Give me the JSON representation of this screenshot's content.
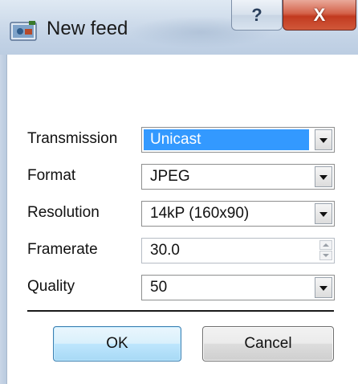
{
  "window": {
    "title": "New feed",
    "help_glyph": "?",
    "close_glyph": "X",
    "icon": "camera-feed-icon"
  },
  "form": {
    "transmission": {
      "label": "Transmission",
      "value": "Unicast",
      "selected": true
    },
    "format": {
      "label": "Format",
      "value": "JPEG"
    },
    "resolution": {
      "label": "Resolution",
      "value": "14kP (160x90)"
    },
    "framerate": {
      "label": "Framerate",
      "value": "30.0"
    },
    "quality": {
      "label": "Quality",
      "value": "50"
    }
  },
  "buttons": {
    "ok_label": "OK",
    "cancel_label": "Cancel"
  },
  "colors": {
    "selection": "#3399ff",
    "close_button": "#c23a1f",
    "default_button_border": "#3c7fb1"
  }
}
